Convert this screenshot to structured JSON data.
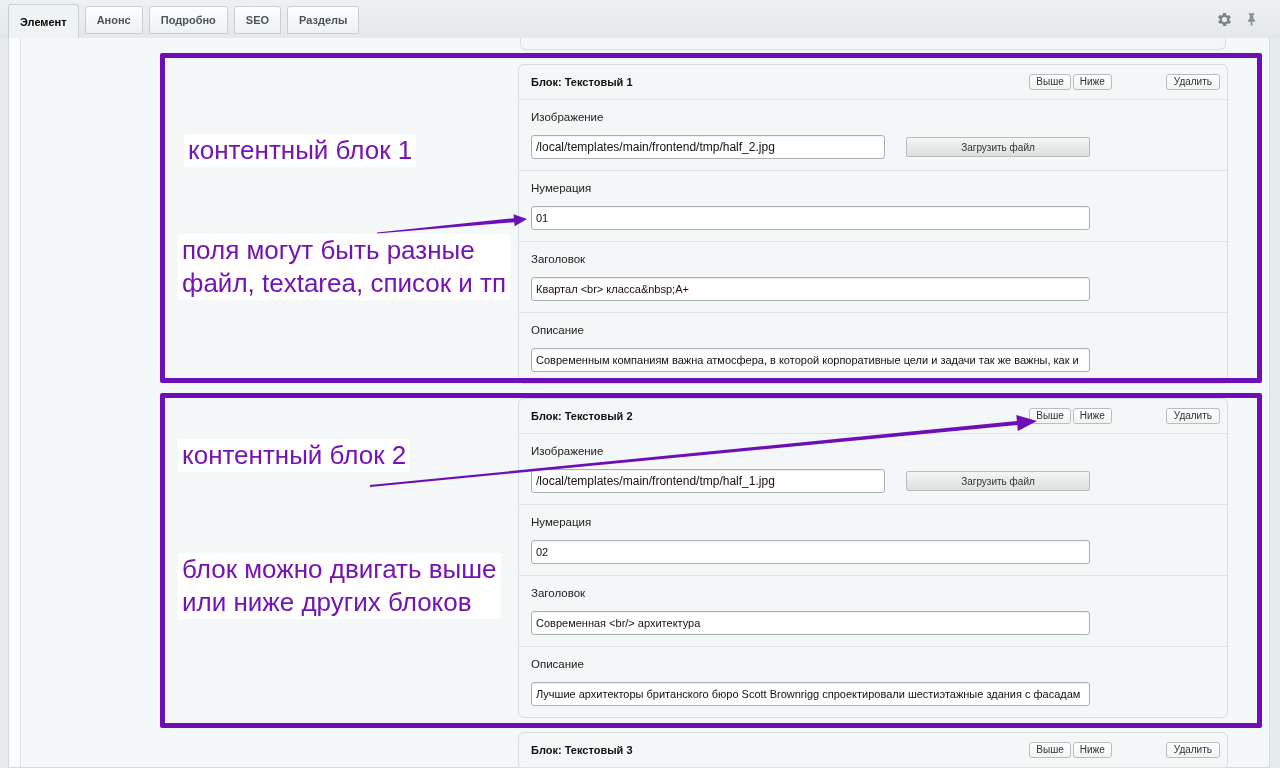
{
  "tabs": [
    {
      "label": "Элемент",
      "selected": true
    },
    {
      "label": "Анонс",
      "selected": false
    },
    {
      "label": "Подробно",
      "selected": false
    },
    {
      "label": "SEO",
      "selected": false
    },
    {
      "label": "Разделы",
      "selected": false
    }
  ],
  "content_blocks": [
    {
      "title": "Блок: Текстовый 1",
      "move_up": "Выше",
      "move_down": "Ниже",
      "delete": "Удалить",
      "fields": [
        {
          "kind": "file",
          "label": "Изображение",
          "value": "/local/templates/main/frontend/tmp/half_2.jpg",
          "button": "Загрузить файл"
        },
        {
          "kind": "text",
          "label": "Нумерация",
          "value": "01"
        },
        {
          "kind": "text",
          "label": "Заголовок",
          "value": "Квартал <br> класса&nbsp;A+"
        },
        {
          "kind": "text",
          "label": "Описание",
          "value": "Современным компаниям важна атмосфера, в которой корпоративные цели и задачи так же важны, как и"
        }
      ]
    },
    {
      "title": "Блок: Текстовый 2",
      "move_up": "Выше",
      "move_down": "Ниже",
      "delete": "Удалить",
      "fields": [
        {
          "kind": "file",
          "label": "Изображение",
          "value": "/local/templates/main/frontend/tmp/half_1.jpg",
          "button": "Загрузить файл"
        },
        {
          "kind": "text",
          "label": "Нумерация",
          "value": "02"
        },
        {
          "kind": "text",
          "label": "Заголовок",
          "value": "Современная <br/> архитектура"
        },
        {
          "kind": "text",
          "label": "Описание",
          "value": "Лучшие архитекторы британского бюро Scott Brownrigg спроектировали шестиэтажные здания с фасадам"
        }
      ]
    },
    {
      "title": "Блок: Текстовый 3",
      "move_up": "Выше",
      "move_down": "Ниже",
      "delete": "Удалить"
    }
  ],
  "annotations": [
    {
      "title": "контентный блок 1",
      "note": "поля могут быть разные\nфайл, textarea, список и тп"
    },
    {
      "title": "контентный блок 2",
      "note": "блок можно двигать выше\nили ниже других блоков"
    }
  ]
}
